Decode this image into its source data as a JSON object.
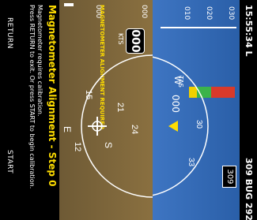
{
  "status": {
    "time": "15:55:34 L",
    "route": "309 BUG 292"
  },
  "airspeed_tape": {
    "ticks": [
      "030",
      "020",
      "010"
    ]
  },
  "altitude_tape": {
    "ticks": [
      "000",
      "000"
    ],
    "label": "KTS"
  },
  "indicators": {
    "tas_label": "TAS",
    "tas_value": "000",
    "gs_value": "000",
    "heading_box": "309",
    "kts_box": "000",
    "kts_label": "KTS"
  },
  "compass": {
    "labels": [
      "W",
      "30",
      "33",
      "24",
      "21",
      "S",
      "15",
      "12",
      "E"
    ]
  },
  "warning": "MAGNETOMETER ALIGNMENT REQUIRED",
  "dialog": {
    "title": "Magnetometer Alignment - Step 0",
    "line1": "Magnetometer requires calibration.",
    "line2": "Press RETURN to exit. Or press START to begin calibration."
  },
  "buttons": {
    "return_label": "RETURN",
    "start_label": "START"
  },
  "colors": {
    "title": "#ffdd00",
    "warning": "#ffdd00",
    "sky": "#3e75c2",
    "ground": "#7a6338"
  }
}
